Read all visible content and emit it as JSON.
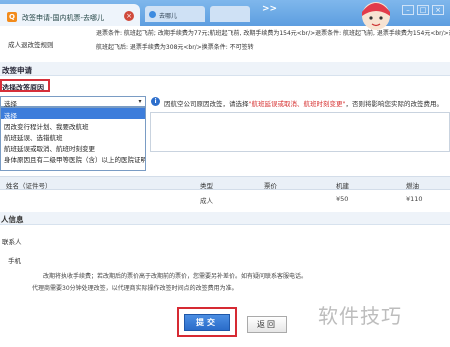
{
  "browser": {
    "tab_title": "改签申请-国内机票-去哪儿",
    "tab_icon_glyph": "Q",
    "tab2_title": "去哪儿",
    "tab3_title": "",
    "nav_right": ">>",
    "window_btns": [
      "–",
      "□",
      "×"
    ]
  },
  "rules": {
    "line1": "退票条件: 航班起飞前; 改期手续费为77元;航班起飞前, 改期手续费为154元<br/>退票条件: 航班起飞前, 退票手续费为154元<br/>退票条件: 航班起飞前",
    "line2": "航班起飞后: 退票手续费为308元<br/>换票条件: 不可签转",
    "row_label": "成人退改签规则"
  },
  "change_section": {
    "title": "改签申请",
    "reason_label": "选择改签原因",
    "select_value": "选择",
    "options": [
      "选择",
      "因改变行程计划、我要改航班",
      "航班延误、选错航班",
      "航班延误或取消、航班时刻变更",
      "身体原因且有二级甲等医院（含）以上的医院证明"
    ],
    "selected_index": 0,
    "info_prefix": "因航空公司原因改签，请选择",
    "info_highlight": "\"航班延误或取消、航班时刻变更\"",
    "info_suffix": "，否则将影响您实际的改签费用。"
  },
  "passengers": {
    "headers": [
      "姓名（证件号）",
      "类型",
      "票价",
      "机建",
      "燃油"
    ],
    "rows": [
      {
        "name": "",
        "type": "成人",
        "price": "",
        "airport_fee": "¥50",
        "fuel": "¥110"
      }
    ]
  },
  "contact": {
    "title": "人信息",
    "contact_label": "联系人",
    "mobile_label": "手机",
    "note1": "改期将执收手续费；若改期后的票价高于改期前的票价，您需要另补差价。如有疑问联系客服电话。",
    "note2": "代理商需要30分钟处理改签，以代理商实际操作改签时间点的改签费用为准。"
  },
  "actions": {
    "submit_label": "提交",
    "back_label": "返回"
  },
  "watermark": "软件技巧",
  "colors": {
    "accent_blue": "#2e6fcc",
    "highlight_red": "#d62e2e",
    "outline_red": "#d6303a"
  }
}
